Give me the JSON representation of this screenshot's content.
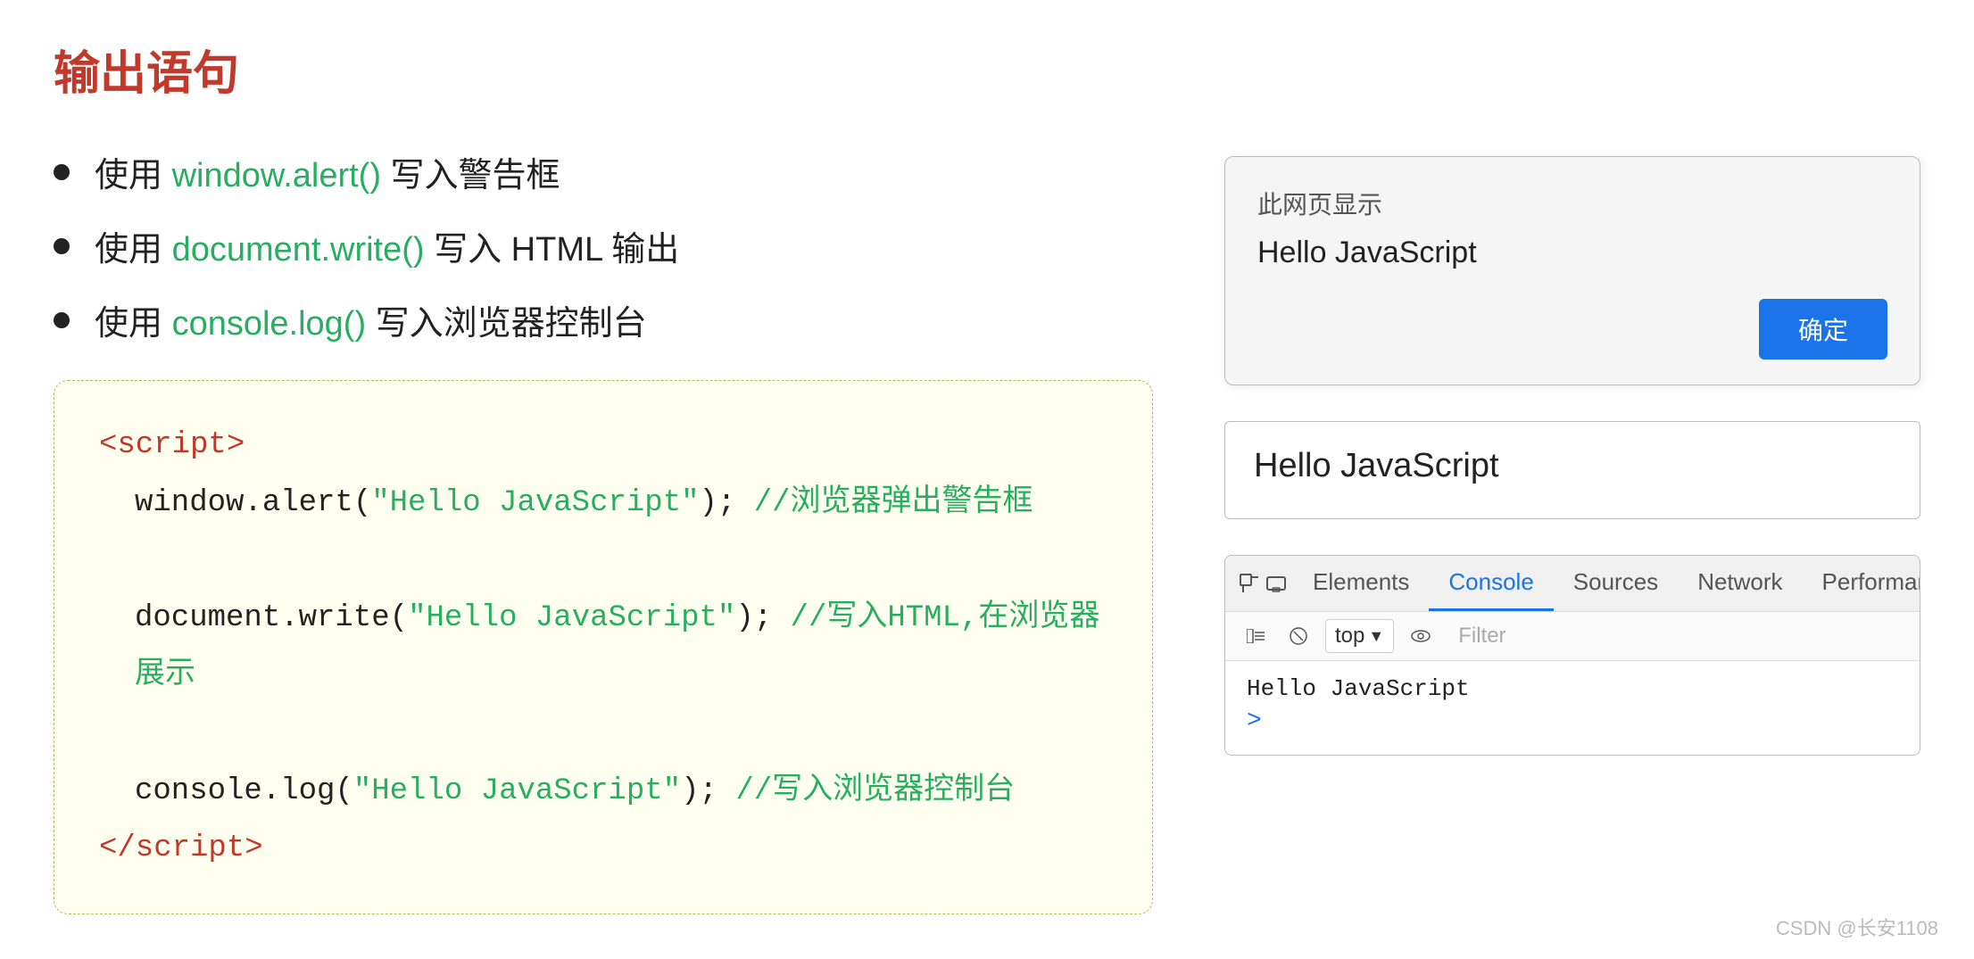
{
  "title": "输出语句",
  "bullets": [
    {
      "prefix": "使用 ",
      "highlight": "window.alert()",
      "suffix": " 写入警告框"
    },
    {
      "prefix": "使用 ",
      "highlight": "document.write()",
      "suffix": " 写入 HTML 输出"
    },
    {
      "prefix": "使用 ",
      "highlight": "console.log()",
      "suffix": " 写入浏览器控制台"
    }
  ],
  "code": {
    "open_tag": "<script>",
    "line1_plain": "window.alert(",
    "line1_string": "\"Hello JavaScript\"",
    "line1_suffix": "); ",
    "line1_comment": "//浏览器弹出警告框",
    "line2_plain": "document.write(",
    "line2_string": "\"Hello JavaScript\"",
    "line2_suffix": "); ",
    "line2_comment": "//写入HTML,在浏览器展示",
    "line3_plain": "console.log(",
    "line3_string": "\"Hello JavaScript\"",
    "line3_suffix": "); ",
    "line3_comment": "//写入浏览器控制台",
    "close_tag": "</script>"
  },
  "alert_dialog": {
    "title": "此网页显示",
    "message": "Hello JavaScript",
    "confirm_btn": "确定"
  },
  "doc_output": {
    "text": "Hello JavaScript"
  },
  "console_panel": {
    "tabs": [
      "Elements",
      "Console",
      "Sources",
      "Network",
      "Performance"
    ],
    "active_tab": "Console",
    "top_label": "top",
    "filter_placeholder": "Filter",
    "output_line": "Hello JavaScript",
    "prompt": ">"
  },
  "watermark": "CSDN @长安1108"
}
